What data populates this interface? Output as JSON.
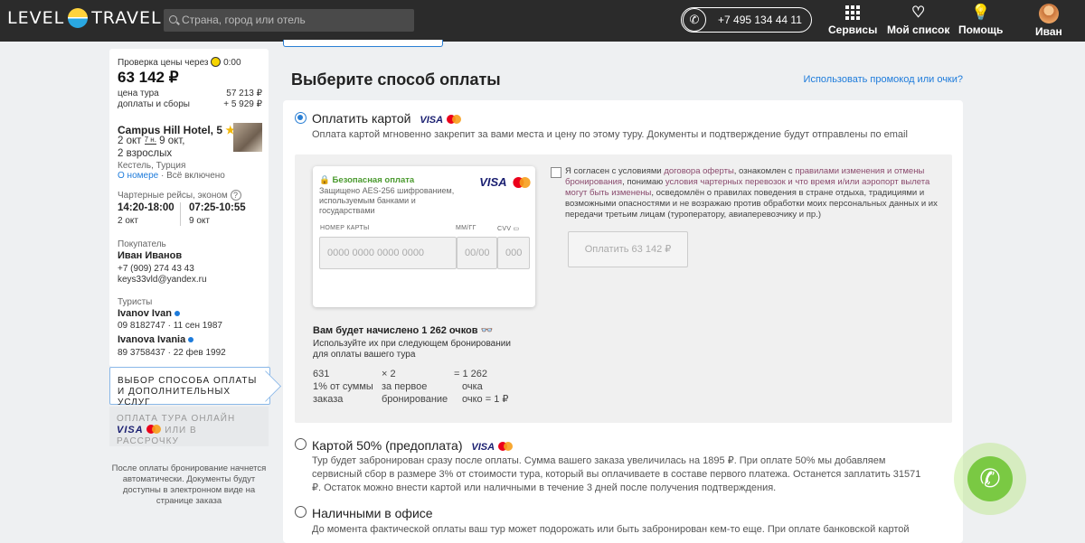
{
  "header": {
    "logo_left": "LEVEL",
    "logo_right": "TRAVEL",
    "search_placeholder": "Страна, город или отель",
    "phone": "+7 495 134 44 11",
    "nav": [
      {
        "label": "Сервисы"
      },
      {
        "label": "Мой список"
      },
      {
        "label": "Помощь"
      },
      {
        "label": "Иван"
      }
    ]
  },
  "sidebar": {
    "price_check_label": "Проверка цены через",
    "price_check_time": "0:00",
    "total_price": "63 142 ₽",
    "tour_price_label": "цена тура",
    "tour_price": "57 213 ₽",
    "fees_label": "доплаты и сборы",
    "fees": "+ 5 929 ₽",
    "hotel_name": "Campus Hill Hotel, 5",
    "date_from": "2 окт",
    "nights": "7 н.",
    "date_to": "9 окт,",
    "guests": "2 взрослых",
    "location": "Кестель, Турция",
    "room_link": "О номере",
    "meal": "· Всё включено",
    "flights_label": "Чартерные рейсы, эконом",
    "flight_out_time": "14:20-18:00",
    "flight_out_date": "2 окт",
    "flight_back_time": "07:25-10:55",
    "flight_back_date": "9 окт",
    "buyer_label": "Покупатель",
    "buyer_name": "Иван Иванов",
    "buyer_phone": "+7 (909) 274 43 43",
    "buyer_email": "keys33vld@yandex.ru",
    "tourists_label": "Туристы",
    "tourist1_name": "Ivanov Ivan",
    "tourist1_doc": "09 8182747 · 11 сен 1987",
    "tourist2_name": "Ivanova Ivania",
    "tourist2_doc": "89 3758437 · 22 фев 1992",
    "step1_line1": "ВЫБОР СПОСОБА ОПЛАТЫ",
    "step1_line2": "И ДОПОЛНИТЕЛЬНЫХ УСЛУГ",
    "step2_line1": "ОПЛАТА ТУРА ОНЛАЙН",
    "step2_line2": "ИЛИ В РАССРОЧКУ",
    "note": "После оплаты бронирование начнется автоматически. Документы будут доступны в электронном виде на странице заказа"
  },
  "main": {
    "title": "Выберите способ оплаты",
    "promo_link": "Использовать промокод или очки?",
    "visa": "VISA",
    "option_card": "Оплатить картой",
    "option_card_desc": "Оплата картой мгновенно закрепит за вами места и цену по этому туру. Документы и подтверждение будут отправлены по email",
    "secure_title": "Безопасная оплата",
    "secure_desc": "Защищено AES-256 шифрованием, используемым банками и государствами",
    "card_number_label": "НОМЕР КАРТЫ",
    "card_number_placeholder": "0000 0000 0000 0000",
    "expiry_label": "ММ/ГГ",
    "expiry_placeholder": "00/00",
    "cvv_label": "CVV",
    "cvv_placeholder": "000",
    "agree_1": "Я согласен с условиями ",
    "agree_link1": "договора оферты",
    "agree_2": ", ознакомлен с ",
    "agree_link2": "правилами изменения и отмены бронирования",
    "agree_3": ", понимаю ",
    "agree_link3": "условия чартерных перевозок и что время и/или аэропорт вылета могут быть изменены",
    "agree_4": ", осведомлён о правилах поведения в стране отдыха, традициями и возможными опасностями и не возражаю против обработки моих персональных данных и их передачи третьим лицам (туроператору, авиаперевозчику и пр.)",
    "pay_button": "Оплатить 63 142 ₽",
    "points_title": "Вам будет начислено 1 262 очков",
    "points_desc1": "Используйте их при следующем бронировании",
    "points_desc2": "для оплаты вашего тура",
    "calc_a1": "631",
    "calc_a2": "1% от суммы",
    "calc_a3": "заказа",
    "calc_b1": "× 2",
    "calc_b2": "за первое",
    "calc_b3": "бронирование",
    "calc_c1": "= 1 262",
    "calc_c2": "очка",
    "calc_c3": "очко = 1 ₽",
    "option_half": "Картой 50% (предоплата)",
    "option_half_desc": "Тур будет забронирован сразу после оплаты. Сумма вашего заказа увеличилась на 1895 ₽. При оплате 50% мы добавляем сервисный сбор в размере 3% от стоимости тура, который вы оплачиваете в составе первого платежа. Останется заплатить 31571 ₽. Остаток можно внести картой или наличными в течение 3 дней после получения подтверждения.",
    "option_cash": "Наличными в офисе",
    "option_cash_desc": "До момента фактической оплаты ваш тур может подорожать или быть забронирован кем-то еще. При оплате банковской картой"
  }
}
